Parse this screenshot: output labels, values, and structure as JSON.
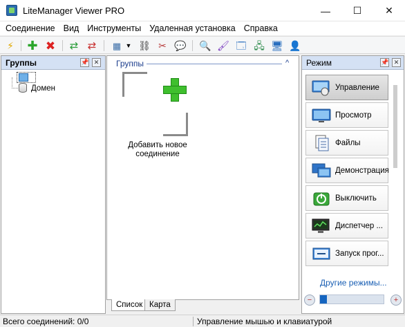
{
  "window": {
    "title": "LiteManager Viewer PRO",
    "minimize": "—",
    "maximize": "☐",
    "close": "✕"
  },
  "menu": [
    "Соединение",
    "Вид",
    "Инструменты",
    "Удаленная установка",
    "Справка"
  ],
  "toolbar": {
    "icons": [
      "lightning-icon",
      "add-icon",
      "delete-icon",
      "connect-icon",
      "disconnect-icon",
      "view-icon",
      "dropdown-icon",
      "binoculars-icon",
      "tools-icon",
      "chat-icon",
      "search-icon",
      "paint-icon",
      "window-icon",
      "network-icon",
      "monitor-icon",
      "user-icon"
    ]
  },
  "left_panel": {
    "title": "Группы",
    "pin": "📌",
    "close": "✕",
    "tree": {
      "child": "Домен"
    }
  },
  "center_panel": {
    "group_header": "Группы",
    "collapse": "^",
    "add_label": "Добавить новое соединение",
    "tabs": [
      "Список",
      "Карта"
    ]
  },
  "right_panel": {
    "title": "Режим",
    "pin": "📌",
    "close": "✕",
    "modes": [
      {
        "label": "Управление",
        "icon": "remote-control-icon",
        "selected": true
      },
      {
        "label": "Просмотр",
        "icon": "view-screen-icon",
        "selected": false
      },
      {
        "label": "Файлы",
        "icon": "files-icon",
        "selected": false
      },
      {
        "label": "Демонстрация",
        "icon": "demo-icon",
        "selected": false
      },
      {
        "label": "Выключить",
        "icon": "power-icon",
        "selected": false
      },
      {
        "label": "Диспетчер ...",
        "icon": "task-manager-icon",
        "selected": false
      },
      {
        "label": "Запуск прог...",
        "icon": "run-program-icon",
        "selected": false
      }
    ],
    "more_link": "Другие режимы...",
    "zoom_out": "−",
    "zoom_in": "+"
  },
  "status": {
    "connections": "Всего соединений:  0/0",
    "mode_hint": "Управление мышью и клавиатурой"
  }
}
